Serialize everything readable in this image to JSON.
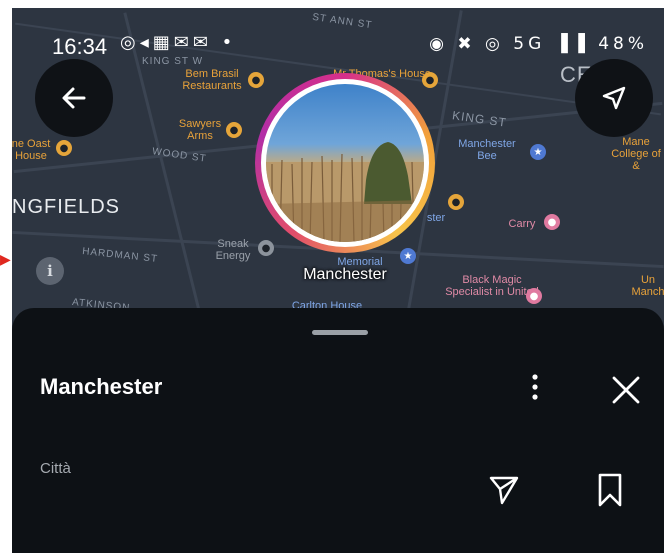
{
  "status_bar": {
    "time": "16:34",
    "left_icons": "◎◂▦✉✉ •",
    "right_icons": "◉ ✖ ◎ 5G ▐▐ 48%"
  },
  "map": {
    "streets": [
      {
        "name": "ST ANN ST"
      },
      {
        "name": "KING ST W"
      },
      {
        "name": "WOOD ST"
      },
      {
        "name": "KING ST"
      },
      {
        "name": "HARDMAN ST"
      },
      {
        "name": "ATKINSON"
      },
      {
        "name": "NGFIELDS"
      }
    ],
    "places": [
      {
        "name": "Bem Brasil Restaurants",
        "color": "orange"
      },
      {
        "name": "Mr Thomas's House",
        "color": "orange"
      },
      {
        "name": "Sawyers Arms",
        "color": "orange"
      },
      {
        "name": "ne Oast House",
        "color": "orange"
      },
      {
        "name": "Manchester Bee",
        "color": "blue"
      },
      {
        "name": "Carry",
        "color": "pink"
      },
      {
        "name": "Sneak Energy",
        "color": "grey"
      },
      {
        "name": "Black Magic Specialist in United",
        "color": "pink"
      },
      {
        "name": "Mane College of &",
        "color": "orange"
      },
      {
        "name": "Un Manch",
        "color": "orange"
      },
      {
        "name": "CE",
        "color": "grey"
      },
      {
        "name": "Carlton House",
        "color": "blue"
      },
      {
        "name": "Memorial",
        "color": "blue"
      },
      {
        "name": "ster",
        "color": "blue"
      }
    ],
    "location_label": "Manchester"
  },
  "controls": {
    "back_icon": "arrow-left-icon",
    "navigate_icon": "navigation-arrow-icon",
    "info_label": "i"
  },
  "sheet": {
    "title": "Manchester",
    "subtitle": "Città",
    "more_icon": "more-vertical-icon",
    "close_icon": "close-icon",
    "share_icon": "send-icon",
    "save_icon": "bookmark-icon"
  },
  "colors": {
    "sheet_bg": "#0d1115",
    "map_bg": "#2d3541",
    "ring_gradient_start": "#d62f8a",
    "ring_gradient_mid": "#f2a13a",
    "annotation_arrow": "#e0281f"
  }
}
